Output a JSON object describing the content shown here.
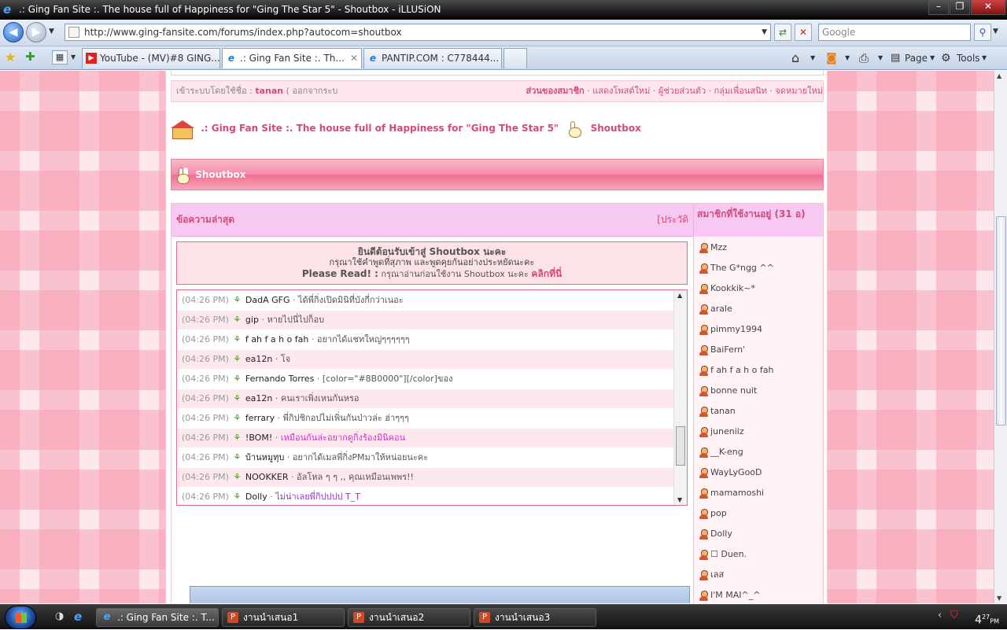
{
  "window": {
    "title": ".: Ging Fan Site :. The house full of Happiness for \"Ging The Star 5\" - Shoutbox - iLLUSiON"
  },
  "address": {
    "url": "http://www.ging-fansite.com/forums/index.php?autocom=shoutbox",
    "search_placeholder": "Google"
  },
  "tabs": [
    {
      "label": "YouTube - (MV)#8 GING...",
      "icon": "youtube-icon"
    },
    {
      "label": ".: Ging Fan Site :. Th...",
      "icon": "ie-icon"
    },
    {
      "label": "PANTIP.COM : C778444...",
      "icon": "ie-icon"
    }
  ],
  "toolbar": {
    "page_label": "Page",
    "tools_label": "Tools"
  },
  "login": {
    "prefix": "เข้าระบบโดยใช้ชื่อ :",
    "user": "tanan",
    "logout": "( ออกจากระบ",
    "member_label": "ส่วนของสมาชิก",
    "links": "· แสดงโพสต์ใหม่ · ผู้ช่วยส่วนตัว · กลุ่มเพื่อนสนิท · จดหมายใหม่"
  },
  "breadcrumb": {
    "site": ".: Ging Fan Site :. The house full of Happiness for \"Ging The Star 5\"",
    "page": "Shoutbox"
  },
  "section_title": "Shoutbox",
  "chat": {
    "heading": "ข้อความล่าสุด",
    "history": "[ประวัติ",
    "welcome_title": "ยินดีต้อนรับเข้าสู่ Shoutbox นะคะ",
    "welcome_line2": "กรุณาใช้คำพูดที่สุภาพ และพูดคุยกันอย่างประหยัดนะคะ",
    "read_label": "Please Read! :",
    "read_text": " กรุณาอ่านก่อนใช้งาน Shoutbox นะคะ ",
    "read_link": "คลิกที่นี่"
  },
  "messages": [
    {
      "time": "(04:26 PM)",
      "user": "DadA GFG",
      "text": "ได้พี่กิ่งเปิดมินิที่บังกี่กว่าเนอะ",
      "color": "#555555"
    },
    {
      "time": "(04:26 PM)",
      "user": "gip",
      "text": "หายไปนี่ไปก็อบ",
      "color": "#555555"
    },
    {
      "time": "(04:26 PM)",
      "user": "f ah f a h o fah",
      "text": "อยากได้แชทใหญ่ๆๆๆๆๆๆ",
      "color": "#555555"
    },
    {
      "time": "(04:26 PM)",
      "user": "ea12n",
      "text": "โจ",
      "color": "#555555"
    },
    {
      "time": "(04:26 PM)",
      "user": "Fernando Torres",
      "text": "[color=\"#8B0000\"][/color]ของ",
      "color": "#555555"
    },
    {
      "time": "(04:26 PM)",
      "user": "ea12n",
      "text": "คนเราเพิ่งเหนกันหรอ",
      "color": "#555555"
    },
    {
      "time": "(04:26 PM)",
      "user": "ferrary",
      "text": "พี่กิปชิกอปไม่เพิ่นกันป่าวล่ะ ฮ่าๆๆๆ",
      "color": "#555555"
    },
    {
      "time": "(04:26 PM)",
      "user": "!BOM!",
      "text": "เหมือนกันล่ะอยากดูกิ่งร้องมินิคอน",
      "color": "#cc33cc"
    },
    {
      "time": "(04:26 PM)",
      "user": "บ้านหมูทุบ",
      "text": "อยากได้เมลพี่กิ่งPMมาให้หน่อยนะคะ",
      "color": "#555555"
    },
    {
      "time": "(04:26 PM)",
      "user": "NOOKKER",
      "text": "อัลโหล ๆ ๆ ,, คุณเหมือนเพพร!!",
      "color": "#555555"
    },
    {
      "time": "(04:26 PM)",
      "user": "Dolly",
      "text": "ไม่น่าเลยพี่กิปปปป T_T",
      "color": "#9933cc"
    }
  ],
  "online": {
    "heading": "สมาชิกที่ใช้งานอยู่ (31 อ)",
    "users": [
      "Mzz",
      "The G*ngg ^^",
      "Kookkik~*",
      "arale",
      "pimmy1994",
      "BaiFern'",
      "f ah f a h o fah",
      "bonne nuit",
      "tanan",
      "juneniiz",
      "__K-eng",
      "WayLyGooD",
      "mamamoshi",
      "pop",
      "Dolly",
      "☐ Duen.",
      "เลส",
      "I'M MAI^_^"
    ]
  },
  "taskbar": {
    "items": [
      {
        "label": ".: Ging Fan Site :. T...",
        "icon": "ie-icon"
      },
      {
        "label": "งานนำเสนอ1",
        "icon": "powerpoint-icon"
      },
      {
        "label": "งานนำเสนอ2",
        "icon": "powerpoint-icon"
      },
      {
        "label": "งานนำเสนอ3",
        "icon": "powerpoint-icon"
      }
    ],
    "clock": "4",
    "clock_min": "27",
    "clock_ampm": "PM"
  }
}
